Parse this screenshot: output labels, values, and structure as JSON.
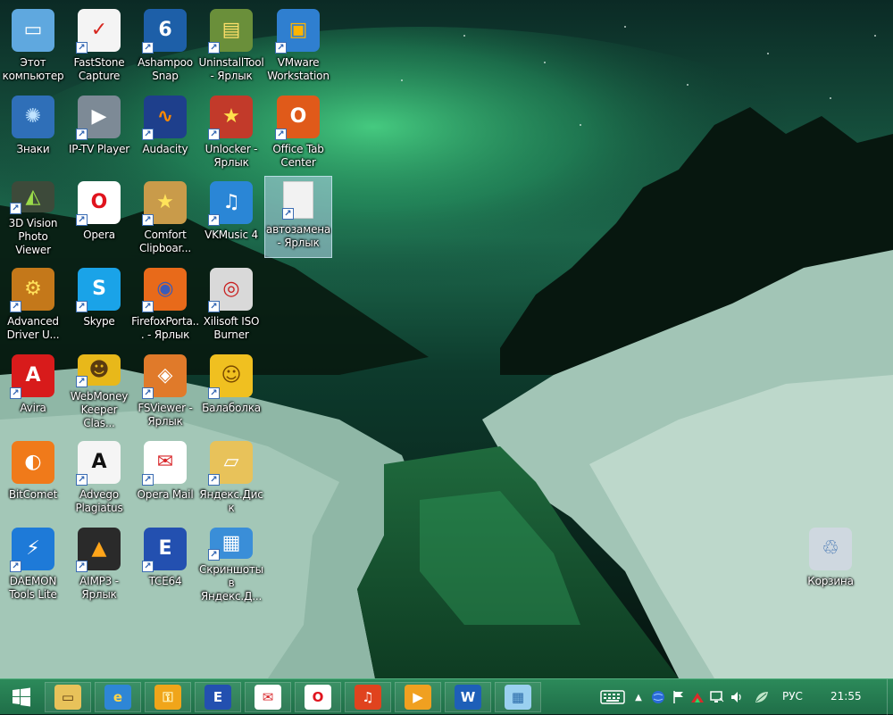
{
  "desktop": {
    "icons": [
      {
        "label": "Этот компьютер",
        "glyph": "▭",
        "bg": "#5fa8df",
        "fg": "#ffffff",
        "shortcut": false
      },
      {
        "label": "FastStone Capture",
        "glyph": "✓",
        "bg": "#f4f4f4",
        "fg": "#d7261e",
        "shortcut": true
      },
      {
        "label": "Ashampoo Snap",
        "glyph": "6",
        "bg": "#1d5fa8",
        "fg": "#ffffff",
        "shortcut": true
      },
      {
        "label": "UninstallTool - Ярлык",
        "glyph": "▤",
        "bg": "#6a8f3a",
        "fg": "#ffe06a",
        "shortcut": true
      },
      {
        "label": "VMware Workstation",
        "glyph": "▣",
        "bg": "#2f7fd0",
        "fg": "#ffb400",
        "shortcut": true
      },
      {
        "label": "Знаки",
        "glyph": "✺",
        "bg": "#2f6fb8",
        "fg": "#bfe3ff",
        "shortcut": false
      },
      {
        "label": "IP-TV Player",
        "glyph": "▶",
        "bg": "#7d8a96",
        "fg": "#ffffff",
        "shortcut": true
      },
      {
        "label": "Audacity",
        "glyph": "∿",
        "bg": "#1e3f8c",
        "fg": "#ff8a00",
        "shortcut": true
      },
      {
        "label": "Unlocker - Ярлык",
        "glyph": "★",
        "bg": "#c23a2a",
        "fg": "#ffe14d",
        "shortcut": true
      },
      {
        "label": "Office Tab Center",
        "glyph": "O",
        "bg": "#e05a1a",
        "fg": "#ffffff",
        "shortcut": true
      },
      {
        "label": "3D Vision Photo Viewer",
        "glyph": "◭",
        "bg": "#3d4a3a",
        "fg": "#9bdc4a",
        "shortcut": true
      },
      {
        "label": "Opera",
        "glyph": "O",
        "bg": "#ffffff",
        "fg": "#e0141e",
        "shortcut": true
      },
      {
        "label": "Comfort Clipboar...",
        "glyph": "★",
        "bg": "#c99b4a",
        "fg": "#ffe35a",
        "shortcut": true
      },
      {
        "label": "VKMusic 4",
        "glyph": "♫",
        "bg": "#2a86d6",
        "fg": "#ffffff",
        "shortcut": true
      },
      {
        "label": "автозамена - Ярлык",
        "glyph": "",
        "bg": "#f2f2f2",
        "fg": "#999999",
        "shortcut": true,
        "selected": true
      },
      {
        "label": "Advanced Driver U...",
        "glyph": "⚙",
        "bg": "#c4781a",
        "fg": "#ffe05a",
        "shortcut": true
      },
      {
        "label": "Skype",
        "glyph": "S",
        "bg": "#1aa3e8",
        "fg": "#ffffff",
        "shortcut": true
      },
      {
        "label": "FirefoxPorta... - Ярлык",
        "glyph": "◉",
        "bg": "#e86a1a",
        "fg": "#3b5bb8",
        "shortcut": true
      },
      {
        "label": "Xilisoft ISO Burner",
        "glyph": "◎",
        "bg": "#d9d9d9",
        "fg": "#c81e1e",
        "shortcut": true
      },
      {
        "label": "Avira",
        "glyph": "A",
        "bg": "#d81b1b",
        "fg": "#ffffff",
        "shortcut": true
      },
      {
        "label": "WebMoney Keeper Clas...",
        "glyph": "☻",
        "bg": "#e8b81a",
        "fg": "#5a3a10",
        "shortcut": true
      },
      {
        "label": "FSViewer - Ярлык",
        "glyph": "◈",
        "bg": "#e07a2a",
        "fg": "#ffffff",
        "shortcut": true
      },
      {
        "label": "Балаболка",
        "glyph": "☺",
        "bg": "#f0c020",
        "fg": "#7a4a00",
        "shortcut": true
      },
      {
        "label": "BitComet",
        "glyph": "◐",
        "bg": "#f07a1a",
        "fg": "#ffffff",
        "shortcut": false
      },
      {
        "label": "Advego Plagiatus",
        "glyph": "A",
        "bg": "#f5f5f5",
        "fg": "#111111",
        "shortcut": true
      },
      {
        "label": "Opera  Mail",
        "glyph": "✉",
        "bg": "#ffffff",
        "fg": "#d8262a",
        "shortcut": true
      },
      {
        "label": "Яндекс.Диск",
        "glyph": "▱",
        "bg": "#e8c25a",
        "fg": "#ffffff",
        "shortcut": true
      },
      {
        "label": "DAEMON Tools Lite",
        "glyph": "⚡",
        "bg": "#1e7ad8",
        "fg": "#ffffff",
        "shortcut": true
      },
      {
        "label": "AIMP3 - Ярлык",
        "glyph": "▲",
        "bg": "#2a2a2a",
        "fg": "#ffa51a",
        "shortcut": true
      },
      {
        "label": "TCE64",
        "glyph": "E",
        "bg": "#2350b0",
        "fg": "#ffffff",
        "shortcut": true
      },
      {
        "label": "Скриншоты в Яндекс.Д...",
        "glyph": "▦",
        "bg": "#3a8ed8",
        "fg": "#ffffff",
        "shortcut": true
      },
      {
        "label": "Корзина",
        "glyph": "♲",
        "bg": "#cfd8e0",
        "fg": "#3a6fb0",
        "shortcut": false
      }
    ]
  },
  "taskbar": {
    "start_glyph": "⊞",
    "items": [
      {
        "name": "file-explorer",
        "glyph": "▭",
        "bg": "#e8c25a",
        "fg": "#5a3a10"
      },
      {
        "name": "internet-explorer",
        "glyph": "e",
        "bg": "#2e86d6",
        "fg": "#ffd54a"
      },
      {
        "name": "keys-app",
        "glyph": "⚿",
        "bg": "#f0a51a",
        "fg": "#fff6c0"
      },
      {
        "name": "tce64",
        "glyph": "E",
        "bg": "#2350b0",
        "fg": "#ffffff"
      },
      {
        "name": "opera-mail",
        "glyph": "✉",
        "bg": "#ffffff",
        "fg": "#d8262a"
      },
      {
        "name": "opera",
        "glyph": "O",
        "bg": "#ffffff",
        "fg": "#e0141e"
      },
      {
        "name": "music-app",
        "glyph": "♫",
        "bg": "#e0431e",
        "fg": "#ffffff"
      },
      {
        "name": "video-app",
        "glyph": "▶",
        "bg": "#f0a020",
        "fg": "#ffffff"
      },
      {
        "name": "word",
        "glyph": "W",
        "bg": "#1e5fb8",
        "fg": "#ffffff"
      },
      {
        "name": "screen-app",
        "glyph": "▦",
        "bg": "#9ad0f0",
        "fg": "#2a6aa8"
      }
    ],
    "tray": {
      "language": "РУС",
      "time": "21:55"
    }
  }
}
